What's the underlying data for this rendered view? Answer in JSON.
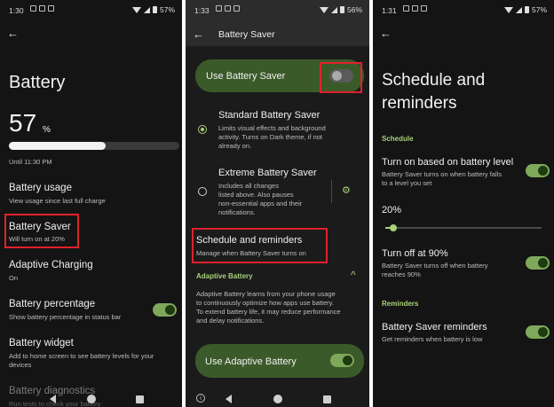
{
  "panel1": {
    "status_time": "1:30",
    "battery_pct": "57%",
    "title": "Battery",
    "level_value": "57",
    "level_unit": "%",
    "level_fraction": 0.57,
    "until": "Until 11:30 PM",
    "items": [
      {
        "title": "Battery usage",
        "sub": "View usage since last full charge"
      },
      {
        "title": "Battery Saver",
        "sub": "Will turn on at 20%"
      },
      {
        "title": "Adaptive Charging",
        "sub": "On"
      },
      {
        "title": "Battery percentage",
        "sub": "Show battery percentage in status bar"
      },
      {
        "title": "Battery widget",
        "sub": "Add to home screen to see battery levels for your",
        "sub2": "devices"
      },
      {
        "title": "Battery diagnostics",
        "sub": "Run tests to check your battery"
      }
    ]
  },
  "panel2": {
    "status_time": "1:33",
    "battery_pct": "56%",
    "header": "Battery Saver",
    "use_saver_label": "Use Battery Saver",
    "standard": {
      "title": "Standard Battery Saver",
      "lines": [
        "Limits visual effects and background",
        "activity. Turns on Dark theme, if not",
        "already on."
      ]
    },
    "extreme": {
      "title": "Extreme Battery Saver",
      "lines": [
        "Includes all changes",
        "listed above. Also pauses",
        "non-essential apps and their",
        "notifications."
      ]
    },
    "schedule": {
      "title": "Schedule and reminders",
      "sub": "Manage when Battery Saver turns on"
    },
    "adaptive_header": "Adaptive Battery",
    "adaptive_text": [
      "Adaptive Battery learns from your phone usage",
      "to continuously optimize how apps use battery.",
      "To extend battery life, it may reduce performance",
      "and delay notifications."
    ],
    "use_adaptive_label": "Use Adaptive Battery"
  },
  "panel3": {
    "status_time": "1:31",
    "battery_pct": "57%",
    "title_line1": "Schedule and",
    "title_line2": "reminders",
    "schedule_header": "Schedule",
    "turn_on": {
      "title": "Turn on based on battery level",
      "lines": [
        "Battery Saver turns on when battery falls",
        "to a level you set"
      ]
    },
    "slider_value": "20%",
    "slider_fraction": 0.05,
    "turn_off": {
      "title": "Turn off at 90%",
      "lines": [
        "Battery Saver turns off when battery",
        "reaches 90%"
      ]
    },
    "reminders_header": "Reminders",
    "reminders": {
      "title": "Battery Saver reminders",
      "sub": "Get reminders when battery is low"
    }
  },
  "colors": {
    "accent_green": "#a8d07a",
    "highlight_red": "#e0212b",
    "pill_green": "#3b5a2a"
  },
  "icons": [
    "back-arrow-icon",
    "wifi-icon",
    "signal-icon",
    "battery-icon",
    "gear-icon",
    "chevron-up-icon",
    "info-icon",
    "nav-back-icon",
    "nav-home-icon",
    "nav-recents-icon"
  ]
}
